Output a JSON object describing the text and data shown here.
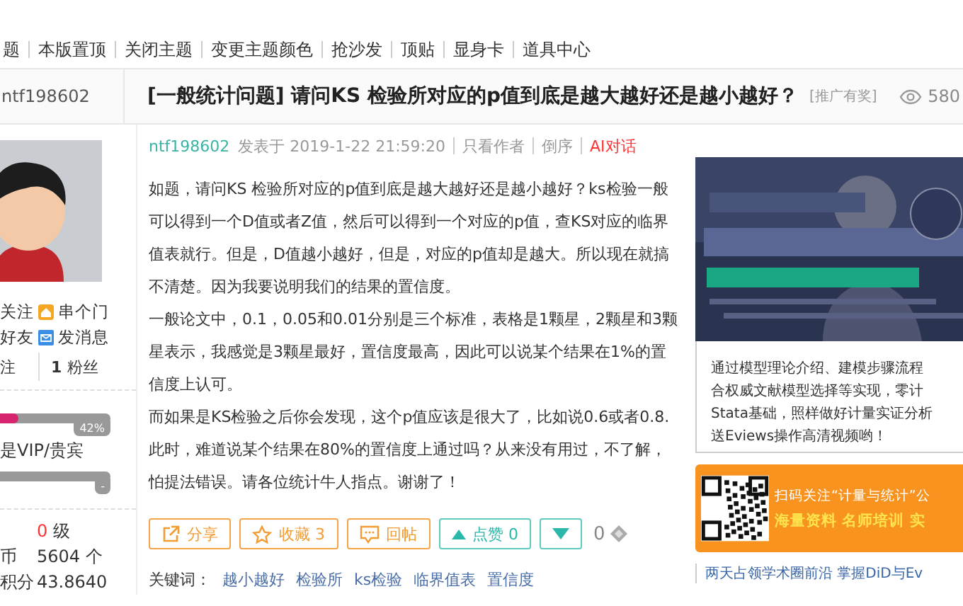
{
  "toolbar": [
    "题",
    "本版置顶",
    "关闭主题",
    "变更主题颜色",
    "抢沙发",
    "顶贴",
    "显身卡",
    "道具中心"
  ],
  "thread": {
    "author": "ntf198602",
    "tag": "[一般统计问题]",
    "title": "请问KS 检验所对应的p值到底是越大越好还是越小越好？",
    "promo": "[推广有奖]",
    "views": "580"
  },
  "sidebar": {
    "links": [
      {
        "lead": "关注",
        "kind": "home",
        "label": "串个门"
      },
      {
        "lead": "好友",
        "kind": "mail",
        "label": "发消息"
      }
    ],
    "stats": [
      {
        "label": "注"
      },
      {
        "value": "1",
        "label": "粉丝"
      }
    ],
    "level_bar": {
      "level": 0.42,
      "reading": "42%"
    },
    "vip_label": "是VIP/贵宾",
    "vip_bar": {
      "level": 0,
      "reading": "-"
    },
    "info": [
      {
        "kind": "level",
        "value": "0",
        "unit": "级"
      },
      {
        "kind": "count",
        "label": "币",
        "value": "5604",
        "unit": "个"
      },
      {
        "kind": "count",
        "label": "积分",
        "value": "43.8640"
      }
    ]
  },
  "post": {
    "author": "ntf198602",
    "posted": "发表于 2019-1-22 21:59:20",
    "links": [
      {
        "kind": "plain",
        "label": "只看作者"
      },
      {
        "kind": "plain",
        "label": "倒序"
      },
      {
        "kind": "ai",
        "label": "AI对话"
      }
    ],
    "paragraphs": [
      "如题，请问KS 检验所对应的p值到底是越大越好还是越小越好？ks检验一般可以得到一个D值或者Z值，然后可以得到一个对应的p值，查KS对应的临界值表就行。但是，D值越小越好，但是，对应的p值却是越大。所以现在就搞不清楚。因为我要说明我们的结果的置信度。",
      "一般论文中，0.1，0.05和0.01分别是三个标准，表格是1颗星，2颗星和3颗星表示，我感觉是3颗星最好，置信度最高，因此可以说某个结果在1%的置信度上认可。",
      "而如果是KS检验之后你会发现，这个p值应该是很大了，比如说0.6或者0.8.此时，难道说某个结果在80%的置信度上通过吗？从来没有用过，不了解，怕提法错误。请各位统计牛人指点。谢谢了！"
    ],
    "buttons": [
      {
        "kind": "share",
        "label": "分享"
      },
      {
        "kind": "star",
        "label": "收藏 3"
      },
      {
        "kind": "reply",
        "label": "回帖"
      },
      {
        "kind": "up",
        "label": "点赞 0"
      },
      {
        "kind": "down"
      }
    ],
    "coins": "0",
    "keywords_label": "关键词：",
    "keywords": [
      "越小越好",
      "检验所",
      "ks检验",
      "临界值表",
      "置信度"
    ]
  },
  "ad": {
    "banner": {
      "kind": "picture"
    },
    "lines": [
      "通过模型理论介绍、建模步骤流程",
      "合权威文献模型选择等实现，零计",
      "Stata基础，照样做好计量实证分析",
      "送Eviews操作高清视频哟！"
    ],
    "promo_lines": [
      "扫码关注“计量与统计”公",
      "海量资料 名师培训 实"
    ],
    "link": "两天占领学术圈前沿 掌握DiD与Ev"
  }
}
